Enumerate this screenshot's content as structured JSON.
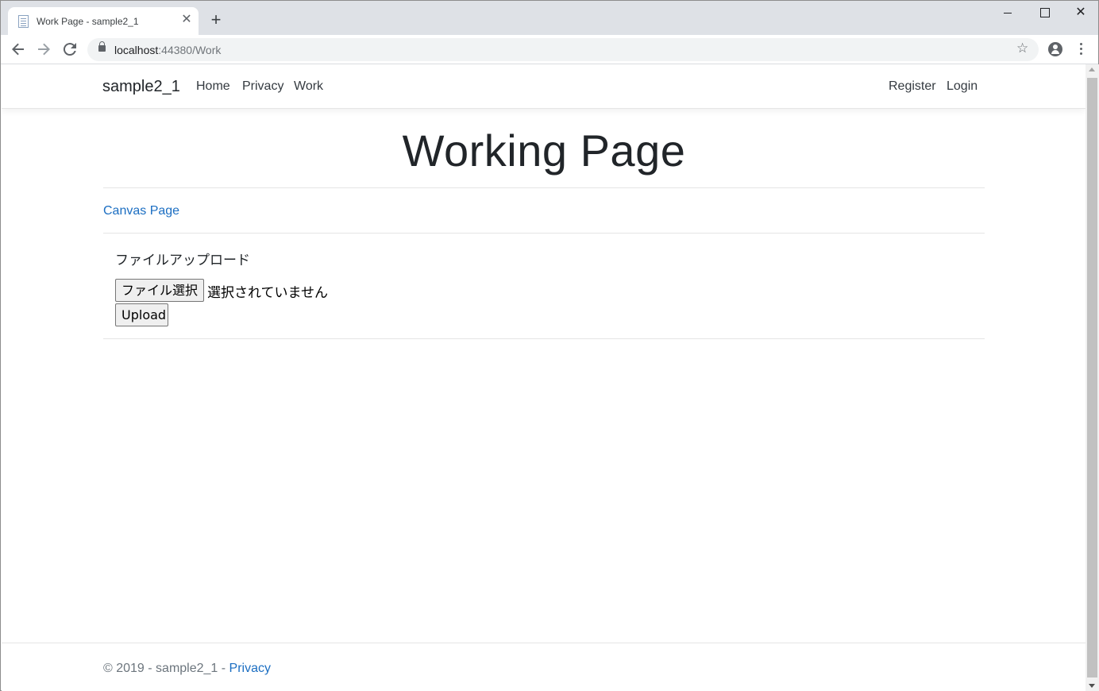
{
  "browser": {
    "tab_title": "Work Page - sample2_1",
    "tab_close": "✕",
    "new_tab": "+",
    "url_host": "localhost",
    "url_rest": ":44380/Work",
    "window_close": "✕"
  },
  "site_nav": {
    "brand": "sample2_1",
    "links": [
      "Home",
      "Privacy",
      "Work"
    ],
    "account": [
      "Register",
      "Login"
    ]
  },
  "main": {
    "title": "Working Page",
    "canvas_link": "Canvas Page",
    "upload_heading": "ファイルアップロード",
    "file_button": "ファイル選択",
    "file_status": "選択されていません",
    "upload_button": "Upload"
  },
  "footer": {
    "text": "© 2019 - sample2_1 - ",
    "privacy_link": "Privacy"
  },
  "colors": {
    "link": "#1b6ec2",
    "text": "#212529",
    "chrome_bg": "#dee1e6"
  }
}
